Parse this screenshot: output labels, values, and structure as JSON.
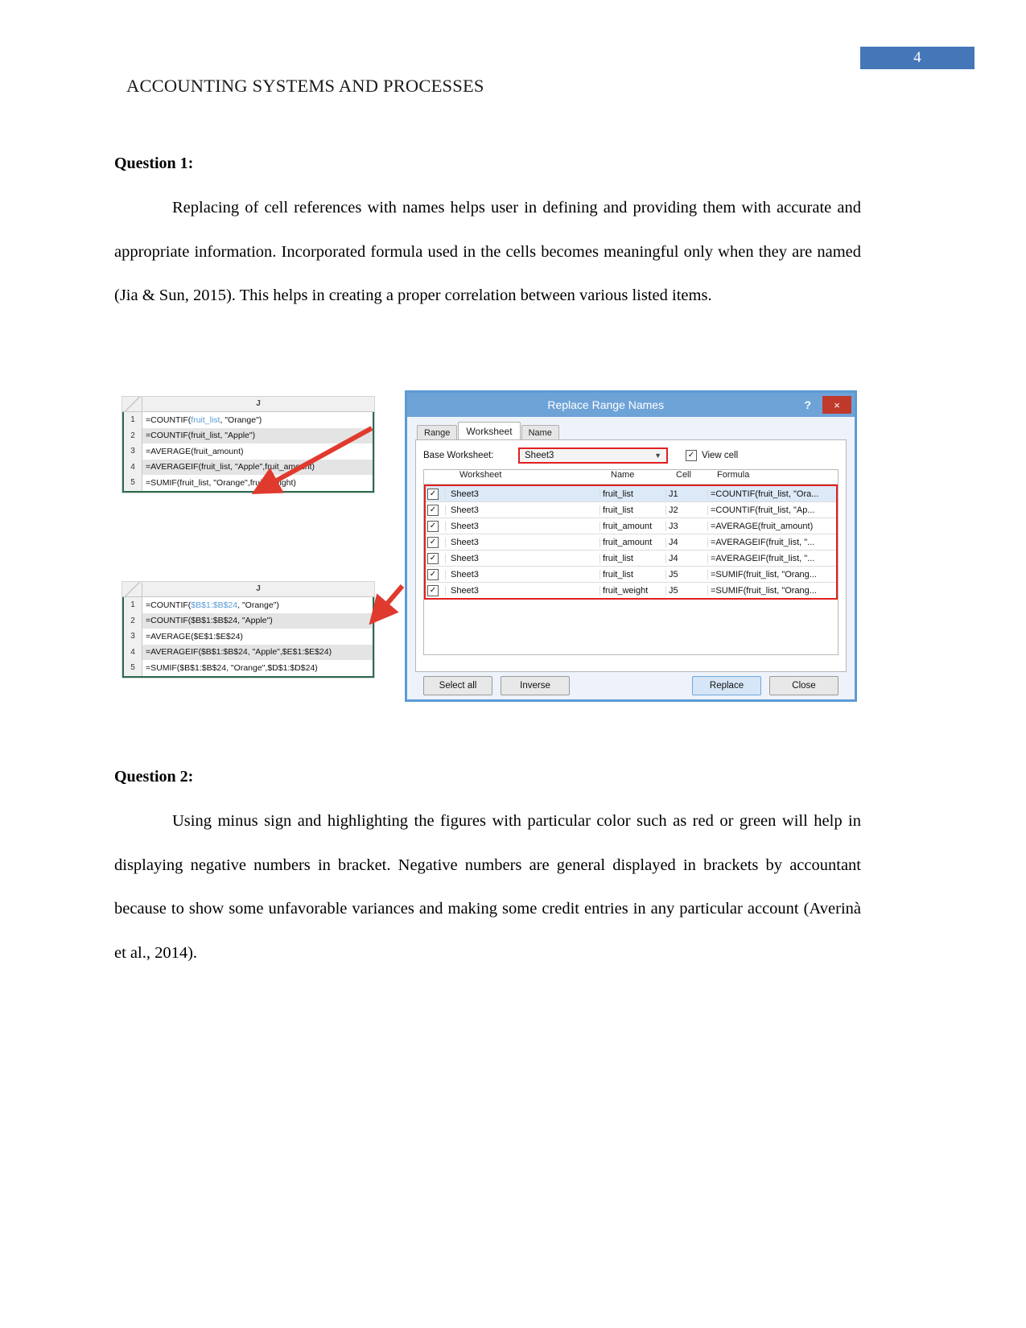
{
  "page": {
    "number": "4"
  },
  "header": {
    "running_title": "ACCOUNTING SYSTEMS AND PROCESSES"
  },
  "sections": [
    {
      "title": "Question 1:",
      "body": "Replacing of cell references with names helps user in defining and providing them with accurate and appropriate information. Incorporated formula used in the cells becomes meaningful only when they are named (Jia & Sun, 2015). This helps in creating a proper correlation between various listed items."
    },
    {
      "title": "Question 2:",
      "body": "Using minus sign and highlighting the figures with particular color such as red or green will help in displaying negative numbers in bracket. Negative numbers are general displayed in brackets by accountant because to show some unfavorable variances and making some credit entries in any particular account (Averinà et al., 2014)."
    }
  ],
  "figure": {
    "sheet_named": {
      "column_header": "J",
      "rows": [
        {
          "num": "1",
          "prefix": "=COUNTIF(",
          "name": "fruit_list",
          "suffix": ", \"Orange\")"
        },
        {
          "num": "2",
          "prefix": "=COUNTIF(fruit_list, \"Apple\")",
          "name": "",
          "suffix": ""
        },
        {
          "num": "3",
          "prefix": "=AVERAGE(fruit_amount)",
          "name": "",
          "suffix": ""
        },
        {
          "num": "4",
          "prefix": "=AVERAGEIF(fruit_list, \"Apple\",fruit_amount)",
          "name": "",
          "suffix": ""
        },
        {
          "num": "5",
          "prefix": "=SUMIF(fruit_list, \"Orange\",fruit_weight)",
          "name": "",
          "suffix": ""
        }
      ]
    },
    "sheet_refs": {
      "column_header": "J",
      "rows": [
        {
          "num": "1",
          "prefix": "=COUNTIF(",
          "name": "$B$1:$B$24",
          "suffix": ", \"Orange\")"
        },
        {
          "num": "2",
          "prefix": "=COUNTIF($B$1:$B$24, \"Apple\")",
          "name": "",
          "suffix": ""
        },
        {
          "num": "3",
          "prefix": "=AVERAGE($E$1:$E$24)",
          "name": "",
          "suffix": ""
        },
        {
          "num": "4",
          "prefix": "=AVERAGEIF($B$1:$B$24, \"Apple\",$E$1:$E$24)",
          "name": "",
          "suffix": ""
        },
        {
          "num": "5",
          "prefix": "=SUMIF($B$1:$B$24, \"Orange\",$D$1:$D$24)",
          "name": "",
          "suffix": ""
        }
      ]
    },
    "dialog": {
      "title": "Replace Range Names",
      "help_label": "?",
      "close_label": "×",
      "tabs": [
        {
          "label": "Range",
          "active": false
        },
        {
          "label": "Worksheet",
          "active": true
        },
        {
          "label": "Name",
          "active": false
        }
      ],
      "base_worksheet_label": "Base Worksheet:",
      "base_worksheet_value": "Sheet3",
      "view_cell_label": "View cell",
      "view_cell_checked": "✓",
      "columns": [
        "Worksheet",
        "Name",
        "Cell",
        "Formula"
      ],
      "rows": [
        {
          "checked": "✓",
          "worksheet": "Sheet3",
          "name": "fruit_list",
          "cell": "J1",
          "formula": "=COUNTIF(fruit_list, \"Ora..."
        },
        {
          "checked": "✓",
          "worksheet": "Sheet3",
          "name": "fruit_list",
          "cell": "J2",
          "formula": "=COUNTIF(fruit_list, \"Ap..."
        },
        {
          "checked": "✓",
          "worksheet": "Sheet3",
          "name": "fruit_amount",
          "cell": "J3",
          "formula": "=AVERAGE(fruit_amount)"
        },
        {
          "checked": "✓",
          "worksheet": "Sheet3",
          "name": "fruit_amount",
          "cell": "J4",
          "formula": "=AVERAGEIF(fruit_list, \"..."
        },
        {
          "checked": "✓",
          "worksheet": "Sheet3",
          "name": "fruit_list",
          "cell": "J4",
          "formula": "=AVERAGEIF(fruit_list, \"..."
        },
        {
          "checked": "✓",
          "worksheet": "Sheet3",
          "name": "fruit_list",
          "cell": "J5",
          "formula": "=SUMIF(fruit_list, \"Orang..."
        },
        {
          "checked": "✓",
          "worksheet": "Sheet3",
          "name": "fruit_weight",
          "cell": "J5",
          "formula": "=SUMIF(fruit_list, \"Orang..."
        }
      ],
      "buttons": {
        "select_all": "Select all",
        "inverse": "Inverse",
        "replace": "Replace",
        "close": "Close"
      }
    },
    "accent_colors": {
      "dialog_border": "#5b9bd5",
      "title_bar": "#6ea3d8",
      "highlight_red": "#e02020",
      "arrow_red": "#e03a2f",
      "banner_blue": "#4577b8"
    }
  }
}
